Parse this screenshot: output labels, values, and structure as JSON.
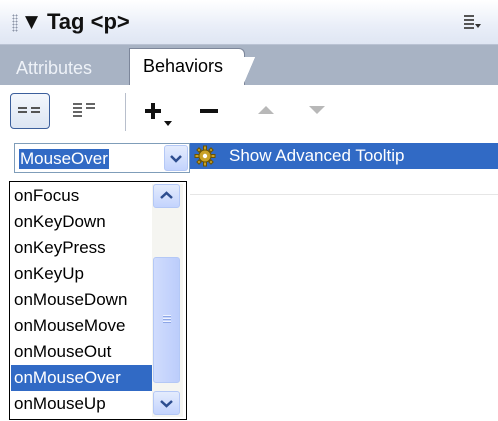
{
  "panel": {
    "title": "Tag <p>",
    "icons": {
      "collapse": "collapse-arrow-icon",
      "options": "options-menu-icon",
      "gripper": "gripper-icon"
    }
  },
  "tabs": [
    {
      "label": "Attributes",
      "active": false
    },
    {
      "label": "Behaviors",
      "active": true
    }
  ],
  "toolbar": {
    "icons": [
      "show-set-events-icon",
      "show-all-events-icon",
      "add-behavior-icon",
      "remove-behavior-icon",
      "move-up-icon",
      "move-down-icon"
    ],
    "add_glyph": "+",
    "remove_glyph": "−",
    "up_glyph": "▲",
    "down_glyph": "▼"
  },
  "behavior": {
    "event": "MouseOver",
    "action": "Show Advanced Tooltip",
    "action_icon": "gear-icon"
  },
  "event_options": [
    "onFocus",
    "onKeyDown",
    "onKeyPress",
    "onKeyUp",
    "onMouseDown",
    "onMouseMove",
    "onMouseOut",
    "onMouseOver",
    "onMouseUp"
  ],
  "selected_option": "onMouseOver",
  "colors": {
    "selection": "#316ac5",
    "tab_strip": "#a8b3c4",
    "panel_header": "#e9eef8"
  }
}
